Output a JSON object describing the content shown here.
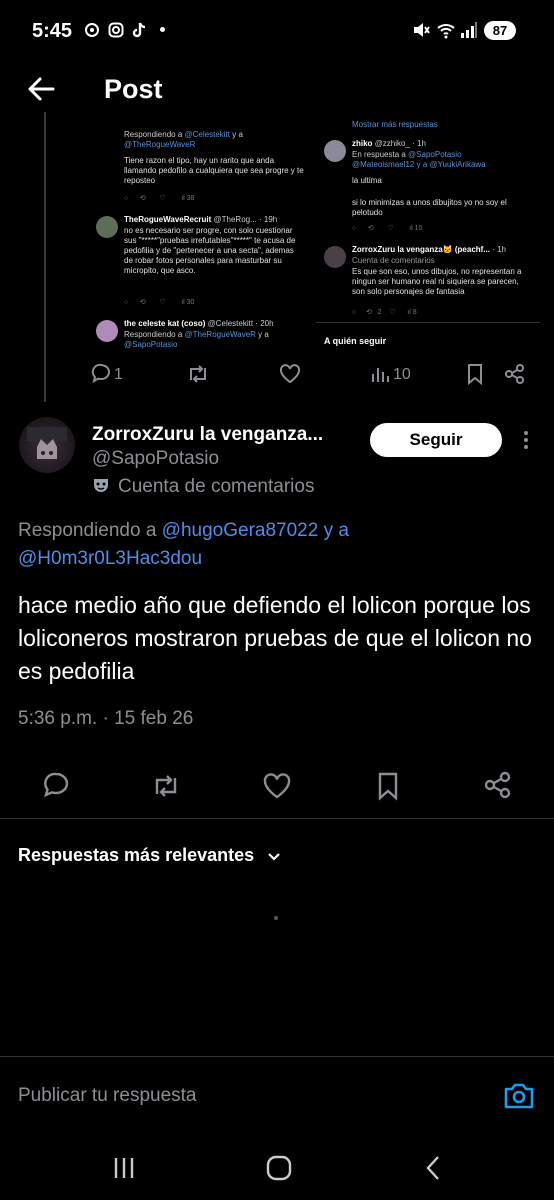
{
  "status_bar": {
    "time": "5:45",
    "battery": "87"
  },
  "header": {
    "title": "Post"
  },
  "embed": {
    "left": [
      {
        "reply_prefix": "Respondiendo a",
        "reply_user1": "@Celestekitt",
        "reply_join": "y a",
        "reply_user2": "@TheRogueWaveR",
        "text": "Tiene razon el tipo, hay un rarito que anda llamando pedofilo a cualquiera que sea progre y te reposteo",
        "likes": "38"
      },
      {
        "name": "TheRogueWaveRecruit",
        "handle": "@TheRog...",
        "time": "19h",
        "text": "no es necesario ser progre, con solo cuestionar sus \"*****\"pruebas irrefutables\"*****\" te acusa de pedofilia y de \"pertenecer a una secta\", ademas de robar fotos personales para masturbar su micropito, que asco.",
        "likes": "30"
      },
      {
        "name": "the celeste kat (coso)",
        "handle": "@Celestekitt",
        "time": "20h",
        "reply_prefix": "Respondiendo a",
        "reply_user1": "@TheRogueWaveR",
        "reply_join": "y a",
        "reply_user2": "@SapoPotasio"
      }
    ],
    "right": [
      {
        "top_text": "Mostrar más respuestas"
      },
      {
        "name": "zhiko",
        "handle": "@zzhiko_",
        "time": "1h",
        "reply_prefix": "En respuesta a",
        "reply_user1": "@SapoPotasio",
        "reply_user2": "@Mateoismael12 y a @YuukiArikawa",
        "text1": "la ultima",
        "text2": "si lo minimizas a unos dibujitos yo no soy el pelotudo",
        "views": "10"
      },
      {
        "name": "ZorroxZuru la venganza🐱 (peachf...",
        "time": "1h",
        "acct": "Cuenta de comentarios",
        "text": "Es que son eso, unos dibujos, no representan a ningun ser humano real ni siquiera se parecen, son solo personajes de fantasia",
        "replies": "2",
        "views": "8"
      }
    ],
    "follow_title": "A quién seguir"
  },
  "upper_actions": {
    "replies": "1",
    "views": "10"
  },
  "post": {
    "author_name": "ZorroxZuru la venganza...",
    "author_handle": "@SapoPotasio",
    "account_label": "Cuenta de comentarios",
    "follow_label": "Seguir",
    "reply_prefix": "Respondiendo a",
    "reply_user1": "@hugoGera87022",
    "reply_join": "y a",
    "reply_user2": "@H0m3r0L3Hac3dou",
    "text": "hace medio año que defiendo el lolicon porque los loliconeros mostraron pruebas de que el lolicon no es pedofilia",
    "time": "5:36 p.m.",
    "separator": "·",
    "date": "15 feb 26"
  },
  "sort": {
    "label": "Respuestas más relevantes"
  },
  "reply_box": {
    "placeholder": "Publicar tu respuesta"
  },
  "colors": {
    "accent": "#1d9bf0",
    "mention": "#4e8ee8",
    "muted": "#71767b",
    "background": "#000000"
  }
}
